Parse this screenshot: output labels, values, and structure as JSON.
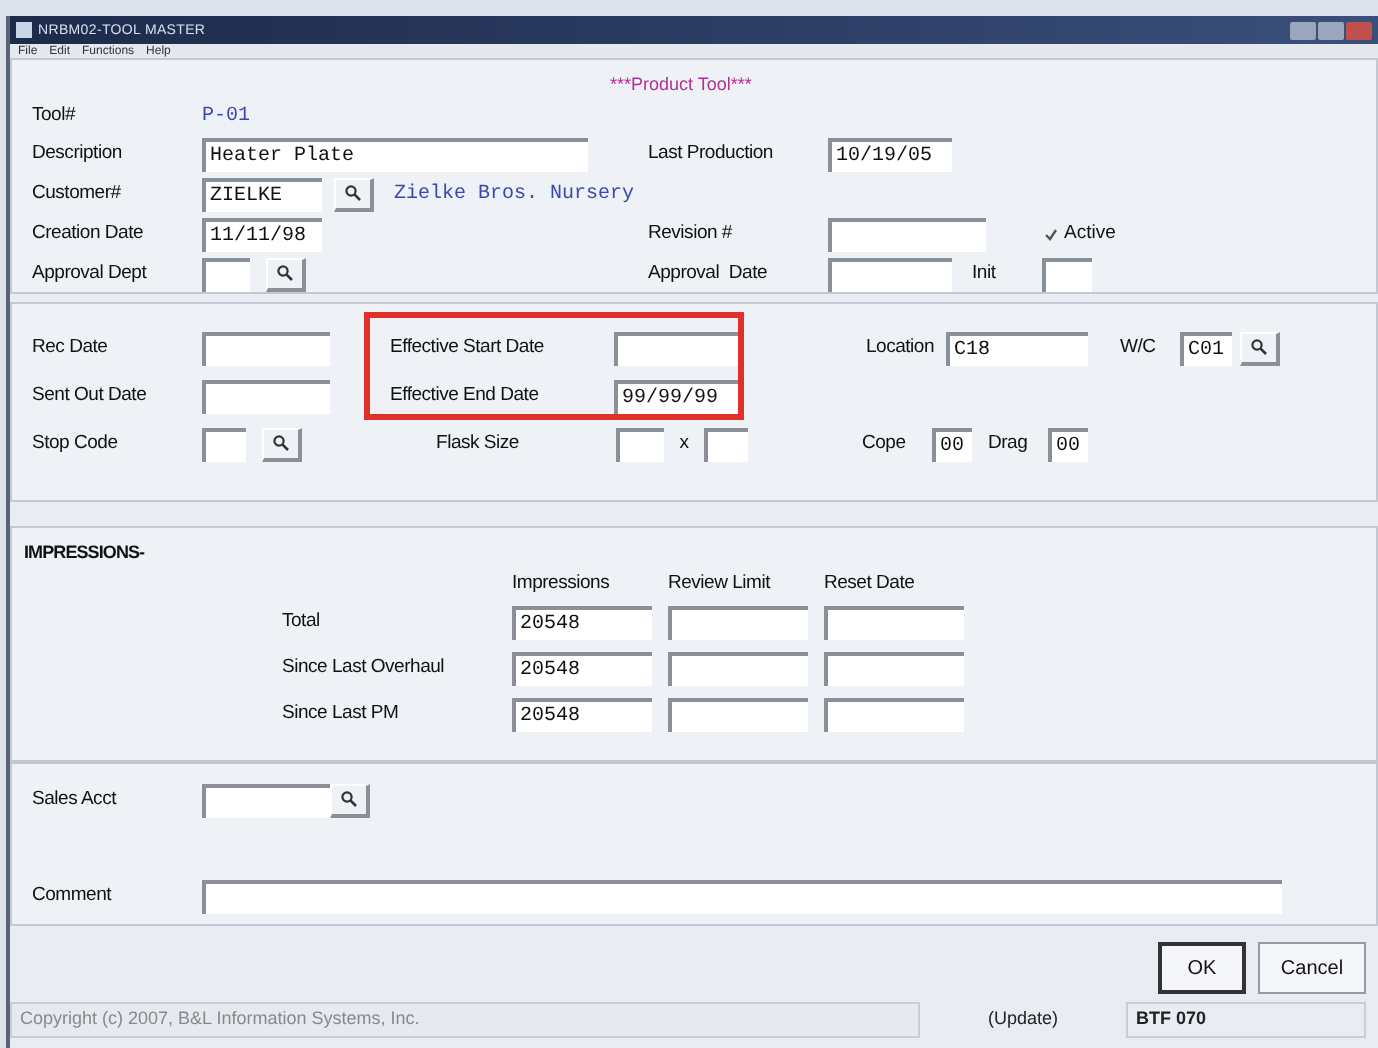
{
  "window": {
    "title": "NRBM02-TOOL MASTER"
  },
  "menu": [
    {
      "label": "File"
    },
    {
      "label": "Edit"
    },
    {
      "label": "Functions"
    },
    {
      "label": "Help"
    }
  ],
  "sections": [
    {
      "kind": "form",
      "rows": [
        {
          "items": [
            {
              "kind": "banner",
              "text": "***Product Tool***"
            }
          ]
        },
        {
          "items": [
            {
              "kind": "label",
              "text": "Tool#"
            },
            {
              "kind": "text",
              "text": "P-01"
            }
          ]
        },
        {
          "items": [
            {
              "kind": "label",
              "text": "Description"
            },
            {
              "kind": "field",
              "value": "Heater Plate"
            },
            {
              "kind": "label",
              "text": "Last Production"
            },
            {
              "kind": "field",
              "value": "10/19/05"
            }
          ]
        },
        {
          "items": [
            {
              "kind": "label",
              "text": "Customer#"
            },
            {
              "kind": "field",
              "value": "ZIELKE"
            },
            {
              "kind": "lookup"
            },
            {
              "kind": "text",
              "text": "Zielke Bros. Nursery"
            }
          ]
        },
        {
          "items": [
            {
              "kind": "label",
              "text": "Creation Date"
            },
            {
              "kind": "field",
              "value": "11/11/98"
            },
            {
              "kind": "label",
              "text": "Revision #"
            },
            {
              "kind": "field"
            },
            {
              "kind": "check",
              "text": "Active",
              "checked": true
            }
          ]
        },
        {
          "items": [
            {
              "kind": "label",
              "text": "Approval Dept"
            },
            {
              "kind": "field"
            },
            {
              "kind": "lookup"
            },
            {
              "kind": "label",
              "text": "Approval  Date"
            },
            {
              "kind": "field"
            },
            {
              "kind": "label",
              "text": "Init"
            },
            {
              "kind": "field"
            }
          ]
        }
      ]
    },
    {
      "kind": "form",
      "highlighted": true,
      "rows": [
        {
          "items": [
            {
              "kind": "label",
              "text": "Rec Date"
            },
            {
              "kind": "field"
            },
            {
              "kind": "label",
              "text": "Effective Start Date"
            },
            {
              "kind": "field"
            },
            {
              "kind": "label",
              "text": "Location"
            },
            {
              "kind": "field",
              "value": "C18"
            },
            {
              "kind": "label",
              "text": "W/C"
            },
            {
              "kind": "field",
              "value": "C01"
            },
            {
              "kind": "lookup"
            }
          ]
        },
        {
          "items": [
            {
              "kind": "label",
              "text": "Sent Out Date"
            },
            {
              "kind": "field"
            },
            {
              "kind": "label",
              "text": "Effective End Date"
            },
            {
              "kind": "field",
              "value": "99/99/99"
            }
          ]
        },
        {
          "items": [
            {
              "kind": "label",
              "text": "Stop Code"
            },
            {
              "kind": "field"
            },
            {
              "kind": "lookup"
            },
            {
              "kind": "label",
              "text": "Flask Size"
            },
            {
              "kind": "field"
            },
            {
              "kind": "label",
              "text": "x"
            },
            {
              "kind": "field"
            },
            {
              "kind": "label",
              "text": "Cope"
            },
            {
              "kind": "field",
              "value": "00"
            },
            {
              "kind": "label",
              "text": "Drag"
            },
            {
              "kind": "field",
              "value": "00"
            }
          ]
        }
      ]
    },
    {
      "kind": "grid",
      "title": "IMPRESSIONS-",
      "columns": [
        "Impressions",
        "Review Limit",
        "Reset Date"
      ],
      "rows": [
        {
          "label": "Total",
          "impressions": "20548"
        },
        {
          "label": "Since Last Overhaul",
          "impressions": "20548"
        },
        {
          "label": "Since Last PM",
          "impressions": "20548"
        }
      ]
    },
    {
      "kind": "form",
      "rows": [
        {
          "items": [
            {
              "kind": "label",
              "text": "Sales Acct"
            },
            {
              "kind": "field"
            },
            {
              "kind": "lookup"
            }
          ]
        },
        {
          "items": [
            {
              "kind": "label",
              "text": "Comment"
            },
            {
              "kind": "field"
            }
          ]
        }
      ]
    }
  ],
  "buttons": [
    {
      "label": "OK",
      "default": true
    },
    {
      "label": "Cancel",
      "default": false
    }
  ],
  "status_bar": {
    "copyright": "Copyright (c) 2007, B&L Information Systems, Inc.",
    "mode": "(Update)",
    "code": "BTF 070"
  }
}
